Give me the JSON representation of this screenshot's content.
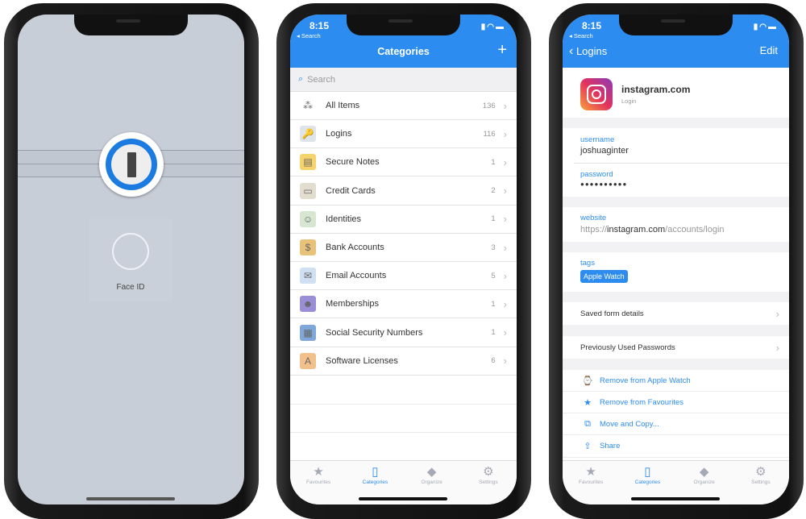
{
  "status": {
    "time": "8:15",
    "back": "◂ Search"
  },
  "lock": {
    "face_id_label": "Face ID"
  },
  "categories": {
    "title": "Categories",
    "add": "+",
    "search_placeholder": "Search",
    "items": [
      {
        "label": "All Items",
        "count": "136",
        "icon": "all-items-icon",
        "glyph": "⁂",
        "color": "#fff"
      },
      {
        "label": "Logins",
        "count": "116",
        "icon": "login-icon",
        "glyph": "🔑",
        "color": "#dfe3ea"
      },
      {
        "label": "Secure Notes",
        "count": "1",
        "icon": "note-icon",
        "glyph": "▤",
        "color": "#f6d36b"
      },
      {
        "label": "Credit Cards",
        "count": "2",
        "icon": "credit-card-icon",
        "glyph": "▭",
        "color": "#e3ddd0"
      },
      {
        "label": "Identities",
        "count": "1",
        "icon": "identity-icon",
        "glyph": "☺",
        "color": "#d6e6d0"
      },
      {
        "label": "Bank Accounts",
        "count": "3",
        "icon": "bank-icon",
        "glyph": "$",
        "color": "#e9c27a"
      },
      {
        "label": "Email Accounts",
        "count": "5",
        "icon": "email-icon",
        "glyph": "✉",
        "color": "#cfe0f2"
      },
      {
        "label": "Memberships",
        "count": "1",
        "icon": "membership-icon",
        "glyph": "☻",
        "color": "#9a8fd6"
      },
      {
        "label": "Social Security Numbers",
        "count": "1",
        "icon": "ssn-icon",
        "glyph": "▦",
        "color": "#7fa7d9"
      },
      {
        "label": "Software Licenses",
        "count": "6",
        "icon": "software-icon",
        "glyph": "A",
        "color": "#f2c08a"
      }
    ]
  },
  "detail": {
    "back": "Logins",
    "edit": "Edit",
    "title": "instagram.com",
    "subtitle": "Login",
    "username_label": "username",
    "username": "joshuaginter",
    "password_label": "password",
    "password": "●●●●●●●●●●",
    "website_label": "website",
    "website_prefix": "https://",
    "website_host": "instagram.com",
    "website_path": "/accounts/login",
    "tags_label": "tags",
    "tag": "Apple Watch",
    "saved_form": "Saved form details",
    "prev_passwords": "Previously Used Passwords",
    "actions": [
      {
        "label": "Remove from Apple Watch",
        "icon": "apple-watch-icon",
        "glyph": "⌚"
      },
      {
        "label": "Remove from Favourites",
        "icon": "star-icon",
        "glyph": "★"
      },
      {
        "label": "Move and Copy...",
        "icon": "copy-icon",
        "glyph": "⧉"
      },
      {
        "label": "Share",
        "icon": "share-icon",
        "glyph": "⇪"
      }
    ]
  },
  "tabs": [
    {
      "label": "Favourites",
      "glyph": "★",
      "icon": "star-icon"
    },
    {
      "label": "Categories",
      "glyph": "▯",
      "icon": "categories-icon"
    },
    {
      "label": "Organize",
      "glyph": "◆",
      "icon": "tag-icon"
    },
    {
      "label": "Settings",
      "glyph": "⚙",
      "icon": "gear-icon"
    }
  ],
  "colors": {
    "accent": "#2d8cf0",
    "lock_bg": "#c8ced8"
  }
}
